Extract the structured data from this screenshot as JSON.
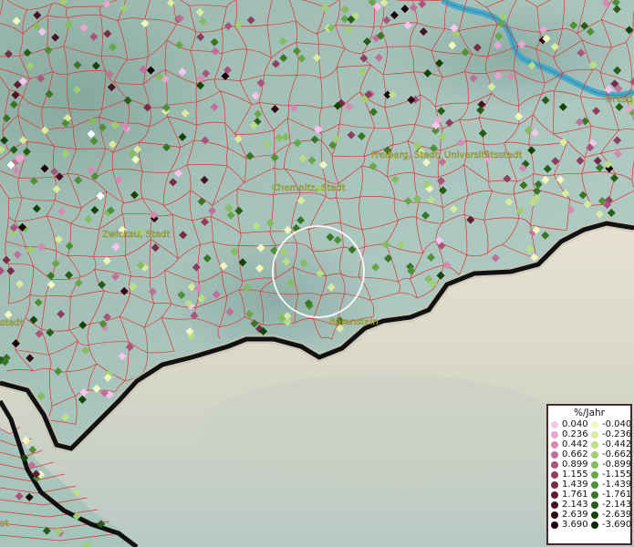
{
  "map": {
    "labels": [
      {
        "text": "Chemnitz, Stadt"
      },
      {
        "text": "Freiberg, Stadt, Universitätsstadt"
      },
      {
        "text": "Zwickau, Stadt"
      },
      {
        "text": "Bärenstein"
      },
      {
        "text": "Dresd"
      },
      {
        "text": "stadt"
      },
      {
        "text": "st"
      }
    ]
  },
  "legend": {
    "title": "%/Jahr",
    "positive": [
      {
        "value": "0.040",
        "color": "#f7c6ef"
      },
      {
        "value": "0.236",
        "color": "#e7a7cf"
      },
      {
        "value": "0.442",
        "color": "#d58ab4"
      },
      {
        "value": "0.662",
        "color": "#c06f99"
      },
      {
        "value": "0.899",
        "color": "#a8547c"
      },
      {
        "value": "1.155",
        "color": "#8e3f60"
      },
      {
        "value": "1.439",
        "color": "#762d48"
      },
      {
        "value": "1.761",
        "color": "#5e1f33"
      },
      {
        "value": "2.143",
        "color": "#481421"
      },
      {
        "value": "2.639",
        "color": "#320a13"
      },
      {
        "value": "3.690",
        "color": "#1a0308"
      }
    ],
    "negative": [
      {
        "value": "-0.040",
        "color": "#f2f7c0"
      },
      {
        "value": "-0.236",
        "color": "#d7ec9e"
      },
      {
        "value": "-0.442",
        "color": "#bcdf86"
      },
      {
        "value": "-0.662",
        "color": "#a0cf71"
      },
      {
        "value": "-0.899",
        "color": "#83bd5d"
      },
      {
        "value": "-1.155",
        "color": "#67a749"
      },
      {
        "value": "-1.439",
        "color": "#4e9037"
      },
      {
        "value": "-1.761",
        "color": "#387626"
      },
      {
        "value": "-2.143",
        "color": "#265e18"
      },
      {
        "value": "-2.639",
        "color": "#15440b"
      },
      {
        "value": "-3.690",
        "color": "#072a03"
      }
    ]
  }
}
